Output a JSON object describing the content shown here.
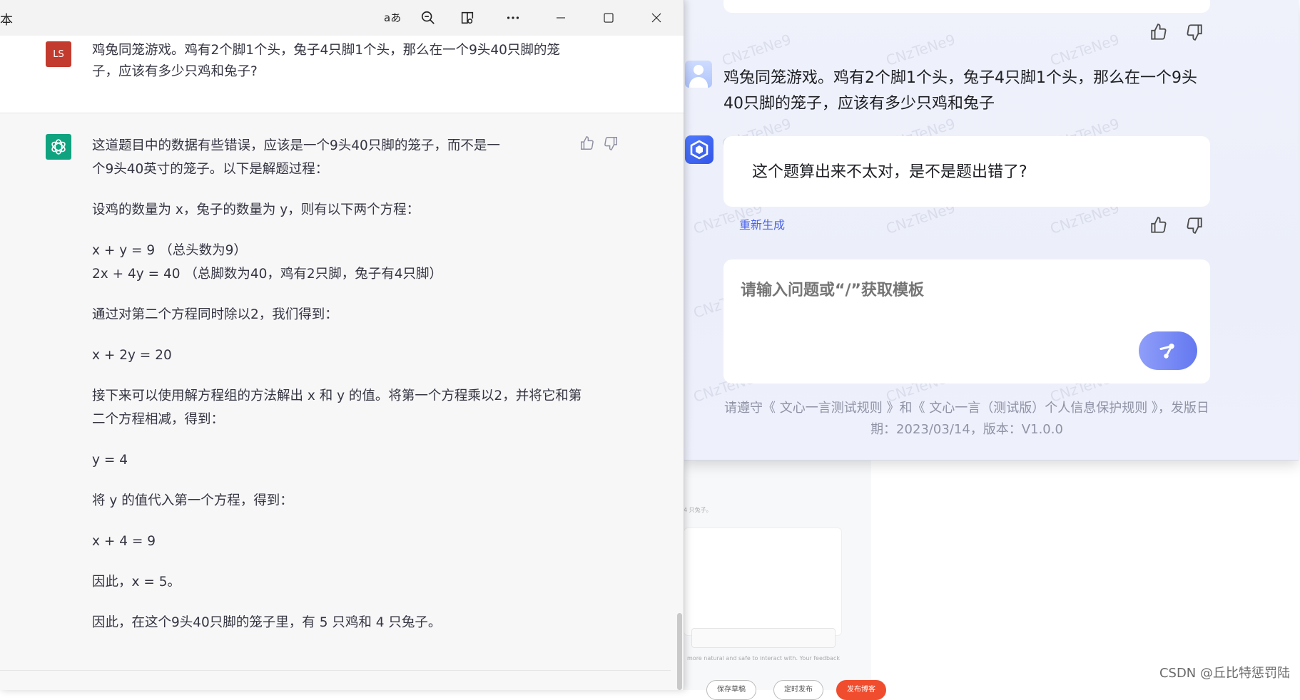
{
  "background": {
    "bg_note_1": "4 只兔子。",
    "bg_note_2": "more natural and safe to interact with. Your feedback",
    "pill_1": "保存草稿",
    "pill_2": "定时发布",
    "pill_3": "发布博客",
    "watermark_csdn": "CSDN @丘比特惩罚陆"
  },
  "wenxin": {
    "watermark": "CNzTeNe9",
    "user_message": "鸡兔同笼游戏。鸡有2个脚1个头，兔子4只脚1个头，那么在一个9头40只脚的笼子，应该有多少只鸡和兔子",
    "bot_message": "这个题算出来不太对，是不是题出错了?",
    "regenerate": "重新生成",
    "input_placeholder": "请输入问题或“/”获取模板",
    "footer": "请遵守《 文心一言测试规则 》和《 文心一言（测试版）个人信息保护规则 》，发版日期：2023/03/14，版本：V1.0.0"
  },
  "chatgpt": {
    "title_partial": "本",
    "user_avatar": "LS",
    "user_message": "鸡兔同笼游戏。鸡有2个脚1个头，兔子4只脚1个头，那么在一个9头40只脚的笼子，应该有多少只鸡和兔子?",
    "answer": {
      "p1": "这道题目中的数据有些错误，应该是一个9头40只脚的笼子，而不是一个9头40英寸的笼子。以下是解题过程：",
      "p2": "设鸡的数量为 x，兔子的数量为 y，则有以下两个方程：",
      "p3a": "x + y = 9  （总头数为9）",
      "p3b": "2x + 4y = 40  （总脚数为40，鸡有2只脚，兔子有4只脚）",
      "p4": "通过对第二个方程同时除以2，我们得到：",
      "p5": "x + 2y = 20",
      "p6": "接下来可以使用解方程组的方法解出 x 和 y 的值。将第一个方程乘以2，并将它和第二个方程相减，得到：",
      "p7": "y = 4",
      "p8": "将 y 的值代入第一个方程，得到：",
      "p9": "x + 4 = 9",
      "p10": "因此，x = 5。",
      "p11": "因此，在这个9头40只脚的笼子里，有 5 只鸡和 4 只兔子。"
    },
    "toolbar_icons": [
      "read-aloud-icon",
      "zoom-out-icon",
      "immersive-reader-icon",
      "more-icon"
    ],
    "window_controls": [
      "minimize-icon",
      "maximize-icon",
      "close-icon"
    ]
  }
}
